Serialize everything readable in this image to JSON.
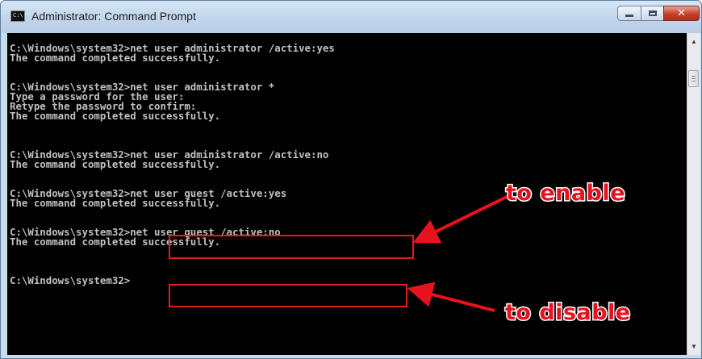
{
  "window": {
    "title": "Administrator: Command Prompt",
    "icon": "cmd-icon",
    "icon_text": "C:\\",
    "controls": [
      "minimize-icon",
      "maximize-icon",
      "close-icon"
    ],
    "close_glyph": "✕"
  },
  "console": {
    "lines": [
      "",
      "C:\\Windows\\system32>net user administrator /active:yes",
      "The command completed successfully.",
      "",
      "",
      "C:\\Windows\\system32>net user administrator *",
      "Type a password for the user:",
      "Retype the password to confirm:",
      "The command completed successfully.",
      "",
      "",
      "",
      "C:\\Windows\\system32>net user administrator /active:no",
      "The command completed successfully.",
      "",
      "",
      "C:\\Windows\\system32>net user guest /active:yes",
      "The command completed successfully.",
      "",
      "",
      "C:\\Windows\\system32>net user guest /active:no",
      "The command completed successfully.",
      "",
      "",
      "",
      "C:\\Windows\\system32>"
    ]
  },
  "annotations": {
    "enable_label": "to enable",
    "disable_label": "to disable",
    "color": "#e8121f"
  },
  "colors": {
    "console_bg": "#000000",
    "console_text": "#c0c0c0",
    "titlebar": "#c3d7ec",
    "close_button": "#c8402a"
  }
}
